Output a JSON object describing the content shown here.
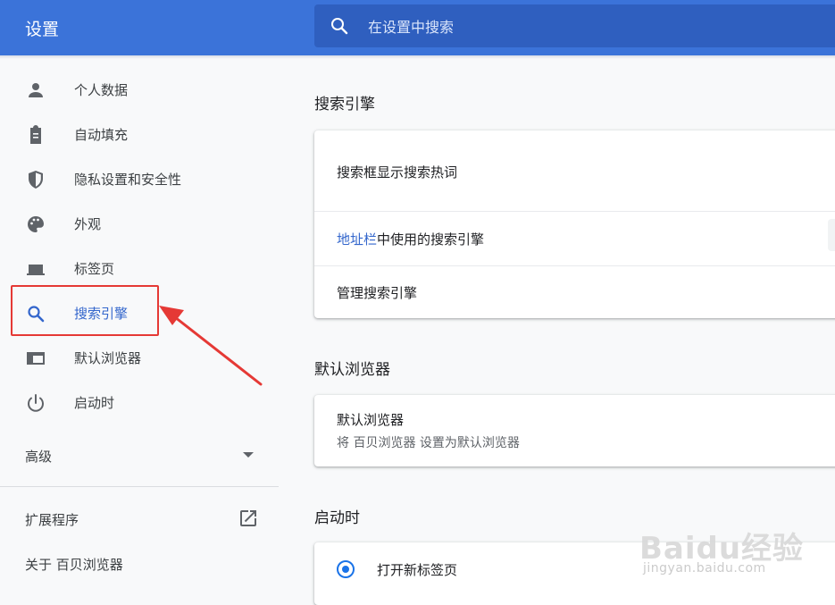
{
  "header": {
    "title": "设置",
    "search_placeholder": "在设置中搜索"
  },
  "sidebar": {
    "items": [
      {
        "label": "个人数据",
        "icon": "person-icon"
      },
      {
        "label": "自动填充",
        "icon": "clipboard-icon"
      },
      {
        "label": "隐私设置和安全性",
        "icon": "shield-icon"
      },
      {
        "label": "外观",
        "icon": "palette-icon"
      },
      {
        "label": "标签页",
        "icon": "laptop-icon"
      },
      {
        "label": "搜索引擎",
        "icon": "search-icon",
        "active": true
      },
      {
        "label": "默认浏览器",
        "icon": "browser-window-icon"
      },
      {
        "label": "启动时",
        "icon": "power-icon"
      }
    ],
    "advanced": "高级",
    "extensions": "扩展程序",
    "about": "关于 百贝浏览器"
  },
  "main": {
    "search_engine": {
      "title": "搜索引擎",
      "rows": [
        {
          "label": "搜索框显示搜索热词"
        },
        {
          "link": "地址栏",
          "label": "中使用的搜索引擎"
        },
        {
          "label": "管理搜索引擎"
        }
      ]
    },
    "default_browser": {
      "title": "默认浏览器",
      "label": "默认浏览器",
      "sub": "将 百贝浏览器 设置为默认浏览器"
    },
    "startup": {
      "title": "启动时",
      "option": "打开新标签页",
      "selected": true
    }
  },
  "watermark": {
    "logo": "Baidu经验",
    "url": "jingyan.baidu.com"
  },
  "colors": {
    "header_bg": "#3b73d9",
    "search_bg": "#2f5fbf",
    "accent": "#3366cc",
    "annotation_red": "#e53935"
  }
}
